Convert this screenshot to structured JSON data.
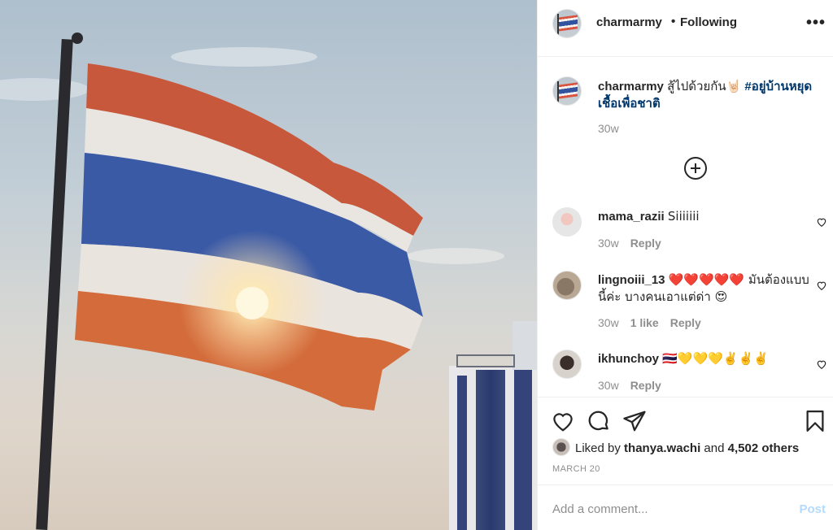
{
  "post": {
    "username": "charmarmy",
    "follow_status": "Following",
    "separator": "•",
    "more_label": "•••",
    "caption_text": "สู้ไปด้วยกัน🤘🏻",
    "caption_hashtag": "#อยู่บ้านหยุดเชื้อเพื่อชาติ",
    "caption_time": "30w"
  },
  "comments": [
    {
      "username": "mama_razii",
      "text": "Siiiiiii",
      "time": "30w",
      "likes": "",
      "reply": "Reply"
    },
    {
      "username": "lingnoiii_13",
      "text": "❤️❤️❤️❤️❤️ มันต้องแบบนี้ค่ะ บางคนเอาแต่ด่า 😍",
      "time": "30w",
      "likes": "1 like",
      "reply": "Reply"
    },
    {
      "username": "ikhunchoy",
      "text": "🇹🇭💛💛💛✌️✌️✌️",
      "time": "30w",
      "likes": "",
      "reply": "Reply"
    }
  ],
  "likes": {
    "prefix": "Liked by",
    "user": "thanya.wachi",
    "and": "and",
    "others": "4,502 others"
  },
  "date": "MARCH 20",
  "add_comment": {
    "placeholder": "Add a comment...",
    "post_label": "Post"
  },
  "icons": {
    "more": "more-icon",
    "load_more": "plus-circle-icon",
    "like": "heart-icon",
    "comment": "comment-icon",
    "share": "paper-plane-icon",
    "save": "bookmark-icon"
  },
  "colors": {
    "hashtag": "#00376b",
    "meta": "#8e8e8e",
    "post_disabled": "#b3dbff"
  }
}
